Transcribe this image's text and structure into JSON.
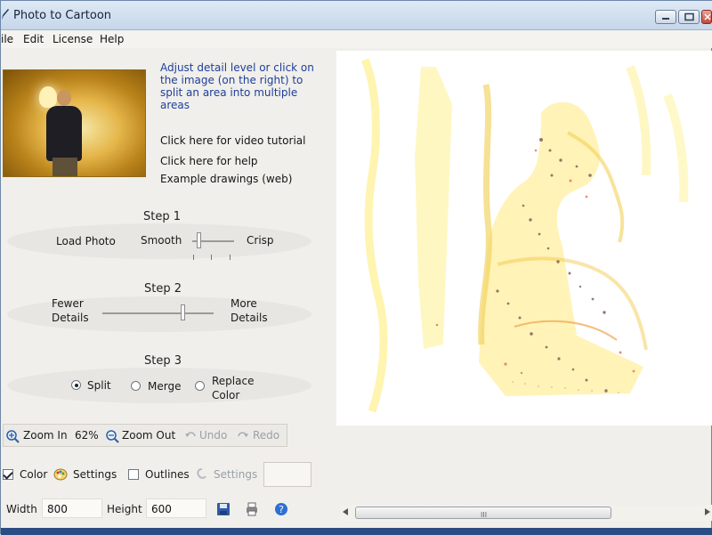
{
  "window": {
    "title": "Photo to Cartoon",
    "buttons": {
      "minimize": "minimize-icon",
      "maximize": "maximize-icon",
      "close": "close-icon"
    }
  },
  "menu": [
    {
      "label": "File",
      "visible": "ile"
    },
    {
      "label": "Edit"
    },
    {
      "label": "License"
    },
    {
      "label": "Help"
    }
  ],
  "info_text": "Adjust detail level or click on the image (on the right) to split an area into multiple areas",
  "links": [
    "Click here for video tutorial",
    "Click here for help",
    "Example drawings (web)"
  ],
  "step1": {
    "title": "Step 1",
    "load_photo": "Load Photo",
    "left_label": "Smooth",
    "right_label": "Crisp",
    "value": 0.1
  },
  "step2": {
    "title": "Step 2",
    "left_label_1": "Fewer",
    "left_label_2": "Details",
    "right_label_1": "More",
    "right_label_2": "Details",
    "value": 0.73
  },
  "step3": {
    "title": "Step 3",
    "options": [
      {
        "label": "Split",
        "selected": true
      },
      {
        "label": "Merge",
        "selected": false
      },
      {
        "label_1": "Replace",
        "label_2": "Color",
        "selected": false
      }
    ]
  },
  "zoom_toolbar": {
    "zoom_in": "Zoom In",
    "zoom_level": "62%",
    "zoom_out": "Zoom Out",
    "undo": "Undo",
    "redo": "Redo"
  },
  "color_toolbar": {
    "color_checked": true,
    "color_label": "Color",
    "settings_label": "Settings",
    "outlines_checked": false,
    "outlines_label": "Outlines",
    "settings_disabled_label": "Settings"
  },
  "size_toolbar": {
    "width_label": "Width",
    "width_value": "800",
    "height_label": "Height",
    "height_value": "600"
  },
  "scrollbar": {
    "grip": "III"
  },
  "colors": {
    "title_text": "#14243a",
    "info_blue": "#1e3e9b",
    "disabled": "#9aa0a6"
  }
}
